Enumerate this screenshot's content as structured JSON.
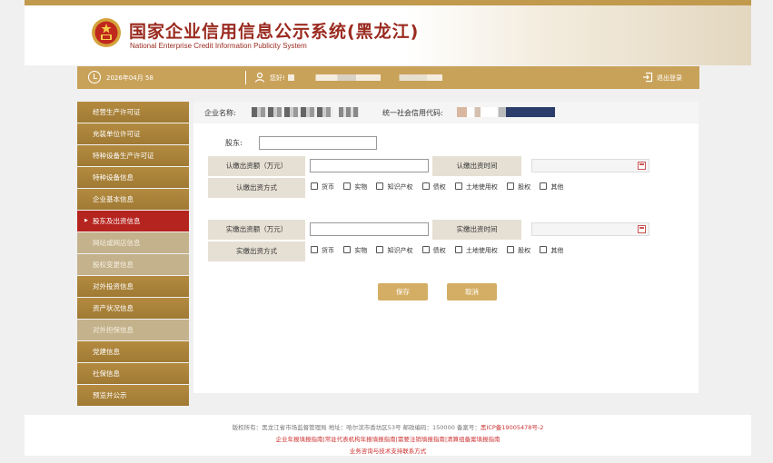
{
  "header": {
    "title": "国家企业信用信息公示系统(黑龙江)",
    "subtitle": "National Enterprise Credit Information Publicity System"
  },
  "infobar": {
    "date": "2026年04月 58",
    "hello": "您好!",
    "logout": "退出登录"
  },
  "sidebar": {
    "items": [
      {
        "label": "经营生产许可证",
        "state": "normal"
      },
      {
        "label": "充装单位许可证",
        "state": "normal"
      },
      {
        "label": "特种设备生产许可证",
        "state": "normal"
      },
      {
        "label": "特种设备信息",
        "state": "normal"
      },
      {
        "label": "企业基本信息",
        "state": "normal"
      },
      {
        "label": "股东及出资信息",
        "state": "active"
      },
      {
        "label": "网站或网店信息",
        "state": "sub"
      },
      {
        "label": "股权变更信息",
        "state": "sub"
      },
      {
        "label": "对外投资信息",
        "state": "normal"
      },
      {
        "label": "资产状况信息",
        "state": "normal"
      },
      {
        "label": "对外担保信息",
        "state": "sub"
      },
      {
        "label": "党建信息",
        "state": "normal"
      },
      {
        "label": "社保信息",
        "state": "normal"
      },
      {
        "label": "预览并公示",
        "state": "normal"
      }
    ]
  },
  "main": {
    "corp_name_label": "企业名称:",
    "credit_code_label": "统一社会信用代码:",
    "shareholder_label": "股东:",
    "shareholder_value": "",
    "subscribed": {
      "amount_label": "认缴出资额（万元）",
      "amount_value": "",
      "time_label": "认缴出资时间",
      "time_value": "",
      "method_label": "认缴出资方式"
    },
    "paid": {
      "amount_label": "实缴出资额（万元）",
      "amount_value": "",
      "time_label": "实缴出资时间",
      "time_value": "",
      "method_label": "实缴出资方式"
    },
    "methods": [
      "货币",
      "实物",
      "知识产权",
      "债权",
      "土地使用权",
      "股权",
      "其他"
    ],
    "save_label": "保存",
    "cancel_label": "取消"
  },
  "footer": {
    "line1": "版权所有：黑龙江省市场监督管理局  地址：哈尔滨市香坊区53号  邮政编码：150000  备案号：",
    "icp": "黑ICP备19005478号-2",
    "line2": "企业年报填报指南|常驻代表机构年报填报指南|需要注销填报指南|清算组备案填报指南",
    "line3": "业务咨询与技术支持联系方式"
  }
}
